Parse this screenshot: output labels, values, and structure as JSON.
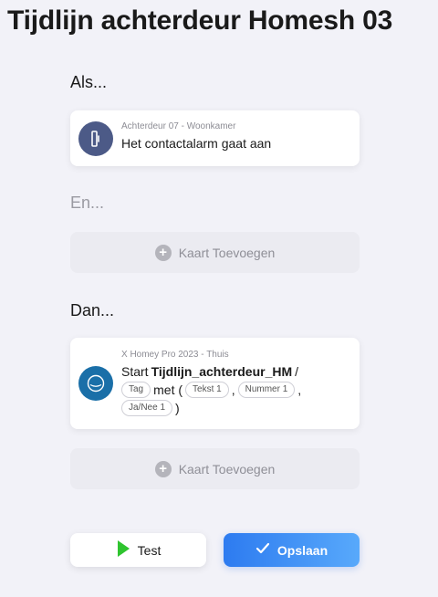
{
  "page": {
    "title": "Tijdlijn achterdeur Homesh 03"
  },
  "sections": {
    "when_label": "Als...",
    "and_label": "En...",
    "then_label": "Dan..."
  },
  "when_card": {
    "device": "Achterdeur 07 - Woonkamer",
    "text": "Het contactalarm gaat aan",
    "icon": "door-sensor-icon",
    "icon_bg": "#4c5a87"
  },
  "and_add": {
    "plus": "+",
    "label": "Kaart Toevoegen"
  },
  "then_card": {
    "device": "X Homey Pro 2023 - Thuis",
    "prefix": "Start",
    "flow": "Tijdlijn_achterdeur_HM",
    "slash": "/",
    "chip_tag": "Tag",
    "with": "met (",
    "chip_text": "Tekst 1",
    "comma1": ",",
    "chip_number": "Nummer 1",
    "comma2": ",",
    "chip_bool": "Ja/Nee 1",
    "close": ")",
    "icon": "homey-icon",
    "icon_bg": "#1a6fa8"
  },
  "then_add": {
    "plus": "+",
    "label": "Kaart Toevoegen"
  },
  "buttons": {
    "test_label": "Test",
    "save_label": "Opslaan",
    "test_icon": "play-icon",
    "save_icon": "check-icon",
    "test_icon_color": "#2fc42f"
  }
}
